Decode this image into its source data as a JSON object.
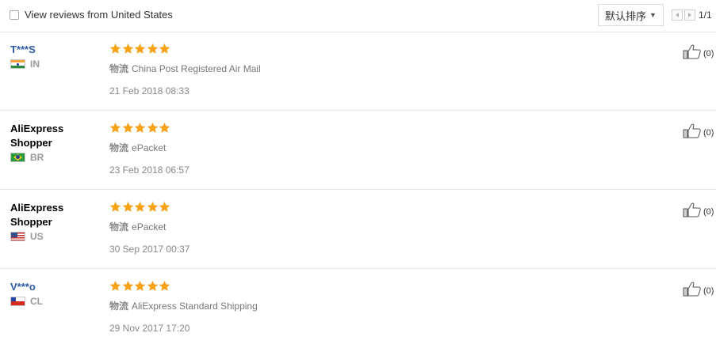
{
  "toolbar": {
    "filter_label": "View reviews from United States",
    "sort_label": "默认排序",
    "page_info": "1/1"
  },
  "colors": {
    "star": "#f7a116",
    "masked_name": "#2b5aa6",
    "separator": "#e8e8e8"
  },
  "icons": {
    "star": "star-icon",
    "thumb": "thumbs-up-icon",
    "chevron": "chevron-down-icon",
    "prev": "prev-page-icon",
    "next": "next-page-icon"
  },
  "reviews": [
    {
      "name": "T***S",
      "name_line2": "",
      "masked": true,
      "country": "IN",
      "flag": "india-flag-icon",
      "stars": 5,
      "ship_label": "物流",
      "shipping": "China Post Registered Air Mail",
      "date": "21 Feb 2018 08:33",
      "helpful": "(0)"
    },
    {
      "name": "AliExpress",
      "name_line2": "Shopper",
      "masked": false,
      "country": "BR",
      "flag": "brazil-flag-icon",
      "stars": 5,
      "ship_label": "物流",
      "shipping": "ePacket",
      "date": "23 Feb 2018 06:57",
      "helpful": "(0)"
    },
    {
      "name": "AliExpress",
      "name_line2": "Shopper",
      "masked": false,
      "country": "US",
      "flag": "usa-flag-icon",
      "stars": 5,
      "ship_label": "物流",
      "shipping": "ePacket",
      "date": "30 Sep 2017 00:37",
      "helpful": "(0)"
    },
    {
      "name": "V***o",
      "name_line2": "",
      "masked": true,
      "country": "CL",
      "flag": "chile-flag-icon",
      "stars": 5,
      "ship_label": "物流",
      "shipping": "AliExpress Standard Shipping",
      "date": "29 Nov 2017 17:20",
      "helpful": "(0)"
    }
  ]
}
